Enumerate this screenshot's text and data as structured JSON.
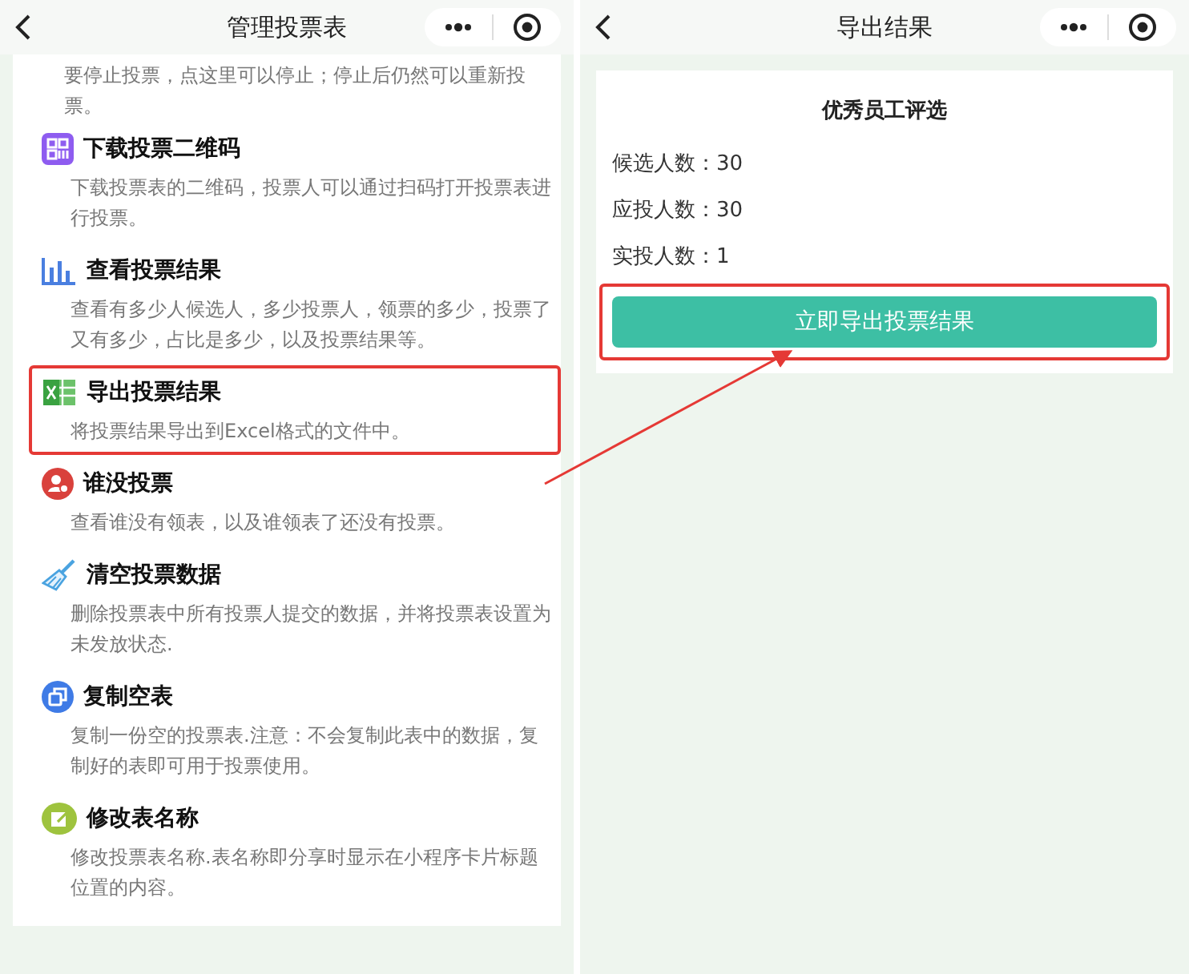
{
  "left_screen": {
    "nav_title": "管理投票表",
    "intro_text": "要停止投票，点这里可以停止；停止后仍然可以重新投票。",
    "items": [
      {
        "title": "下载投票二维码",
        "description": "下载投票表的二维码，投票人可以通过扫码打开投票表进行投票。",
        "highlighted": false
      },
      {
        "title": "查看投票结果",
        "description": "查看有多少人候选人，多少投票人，领票的多少，投票了又有多少，占比是多少，以及投票结果等。",
        "highlighted": false
      },
      {
        "title": "导出投票结果",
        "description": "将投票结果导出到Excel格式的文件中。",
        "highlighted": true
      },
      {
        "title": "谁没投票",
        "description": "查看谁没有领表，以及谁领表了还没有投票。",
        "highlighted": false
      },
      {
        "title": "清空投票数据",
        "description": "删除投票表中所有投票人提交的数据，并将投票表设置为未发放状态.",
        "highlighted": false
      },
      {
        "title": "复制空表",
        "description": "复制一份空的投票表.注意：不会复制此表中的数据，复制好的表即可用于投票使用。",
        "highlighted": false
      },
      {
        "title": "修改表名称",
        "description": "修改投票表名称.表名称即分享时显示在小程序卡片标题位置的内容。",
        "highlighted": false
      }
    ]
  },
  "right_screen": {
    "nav_title": "导出结果",
    "card_title": "优秀员工评选",
    "stats": [
      {
        "label": "候选人数：",
        "value": "30"
      },
      {
        "label": "应投人数：",
        "value": "30"
      },
      {
        "label": "实投人数：",
        "value": "1"
      }
    ],
    "export_button": {
      "label": "立即导出投票结果",
      "highlighted": true
    }
  }
}
